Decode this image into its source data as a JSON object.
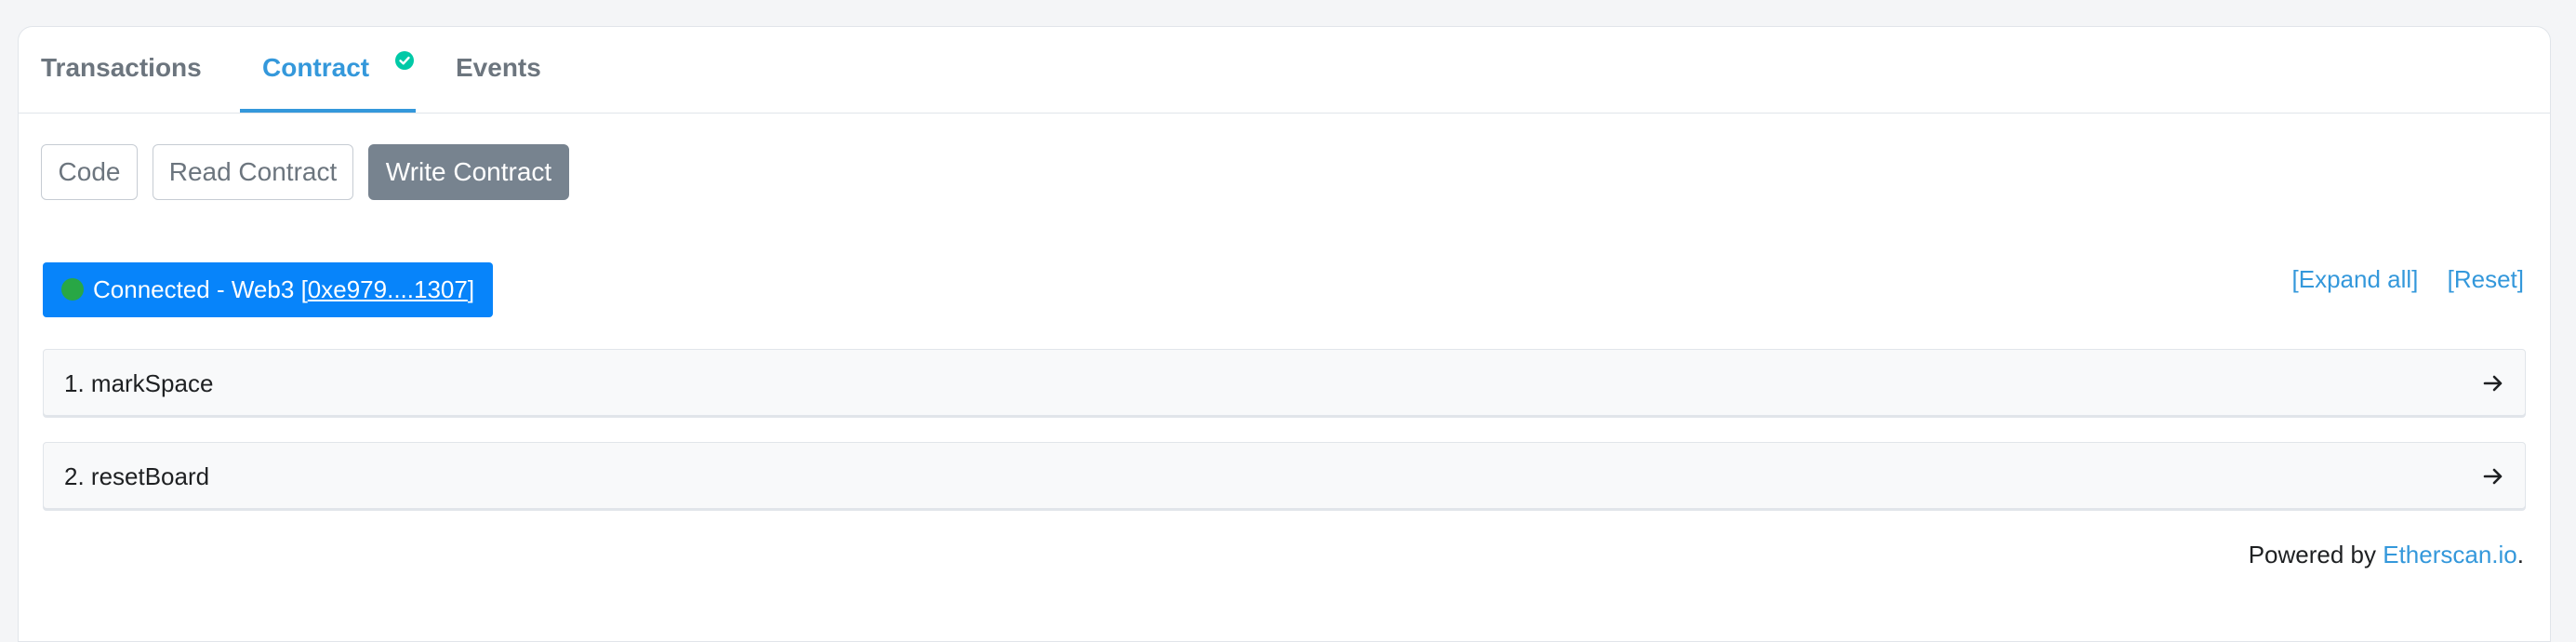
{
  "tabs": {
    "transactions": "Transactions",
    "contract": "Contract",
    "events": "Events"
  },
  "subtabs": {
    "code": "Code",
    "read": "Read Contract",
    "write": "Write Contract"
  },
  "connection": {
    "label": "Connected - Web3",
    "address_open": "[",
    "address": "0xe979....1307",
    "address_close": "]"
  },
  "links": {
    "expand_all": "[Expand all]",
    "reset": "[Reset]"
  },
  "functions": [
    {
      "label": "1. markSpace"
    },
    {
      "label": "2. resetBoard"
    }
  ],
  "footer": {
    "prefix": "Powered by ",
    "link": "Etherscan.io",
    "suffix": "."
  },
  "colors": {
    "accent": "#3498db",
    "connect_bg": "#0784fa",
    "status_green": "#28a745",
    "verified": "#00c9a7",
    "active_subtab": "#77838f"
  },
  "icons": {
    "verified": "check-circle-icon",
    "row_arrow": "arrow-right-icon",
    "status": "status-dot"
  }
}
